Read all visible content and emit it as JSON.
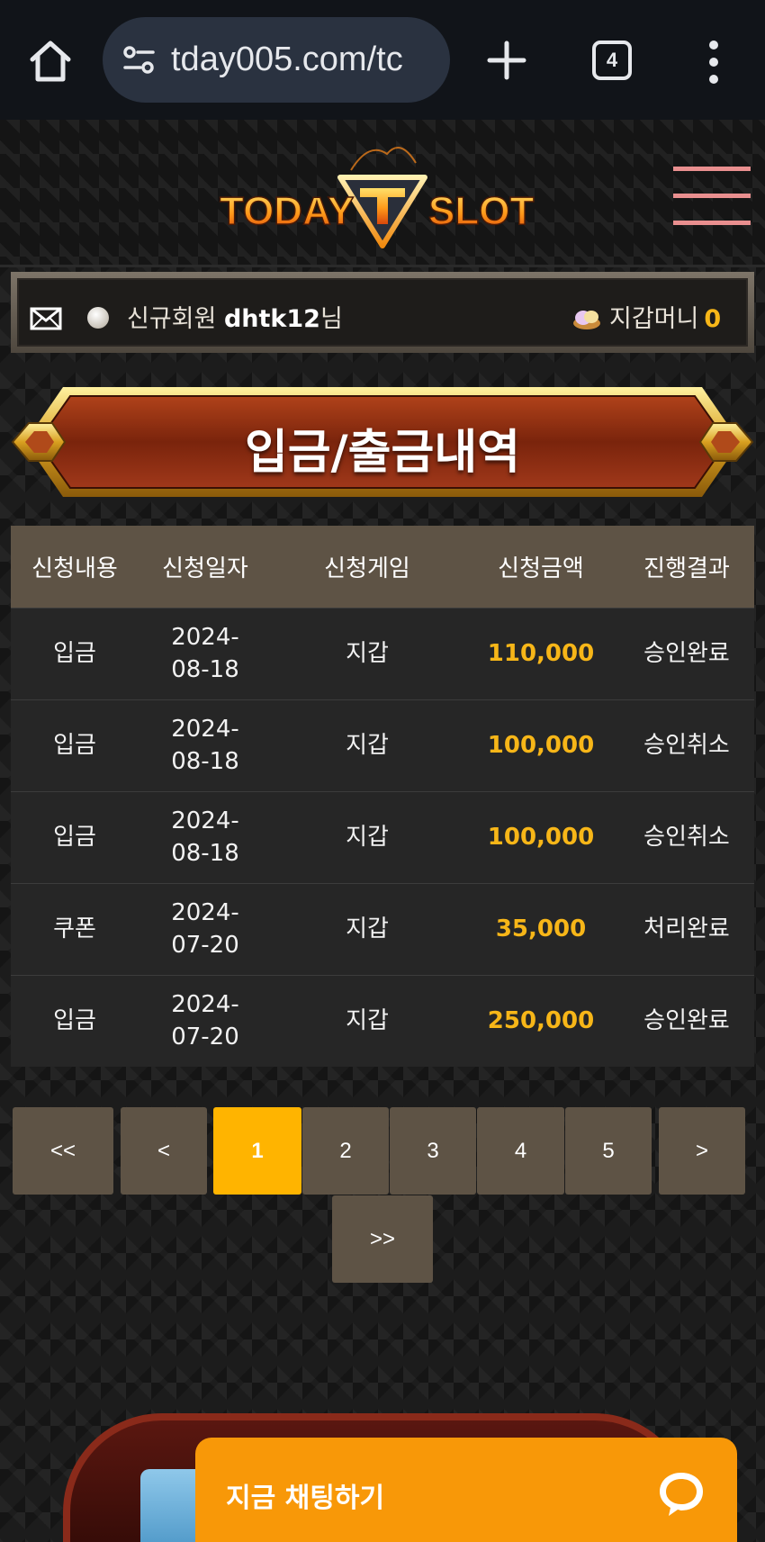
{
  "browser": {
    "url": "tday005.com/tc",
    "tab_count": "4"
  },
  "header": {
    "logo_left": "TODAY",
    "logo_right": "SLOT"
  },
  "user_bar": {
    "member_label": "신규회원",
    "username": "dhtk12",
    "honorific": "님",
    "wallet_label": "지갑머니",
    "wallet_amount": "0"
  },
  "page": {
    "title": "입금/출금내역"
  },
  "table": {
    "headers": [
      "신청내용",
      "신청일자",
      "신청게임",
      "신청금액",
      "진행결과"
    ],
    "rows": [
      {
        "type": "입금",
        "date": "2024-08-18",
        "game": "지갑",
        "amount": "110,000",
        "status": "승인완료"
      },
      {
        "type": "입금",
        "date": "2024-08-18",
        "game": "지갑",
        "amount": "100,000",
        "status": "승인취소"
      },
      {
        "type": "입금",
        "date": "2024-08-18",
        "game": "지갑",
        "amount": "100,000",
        "status": "승인취소"
      },
      {
        "type": "쿠폰",
        "date": "2024-07-20",
        "game": "지갑",
        "amount": "35,000",
        "status": "처리완료"
      },
      {
        "type": "입금",
        "date": "2024-07-20",
        "game": "지갑",
        "amount": "250,000",
        "status": "승인완료"
      }
    ]
  },
  "pagination": {
    "first": "<<",
    "prev": "<",
    "pages": [
      "1",
      "2",
      "3",
      "4",
      "5"
    ],
    "current": "1",
    "next": ">",
    "last": ">>"
  },
  "chat": {
    "label": "지금 채팅하기"
  },
  "colors": {
    "accent": "#f7b618",
    "table_header": "#5e5345",
    "chat_button": "#f89808",
    "menu_lines": "#e98f8f"
  }
}
